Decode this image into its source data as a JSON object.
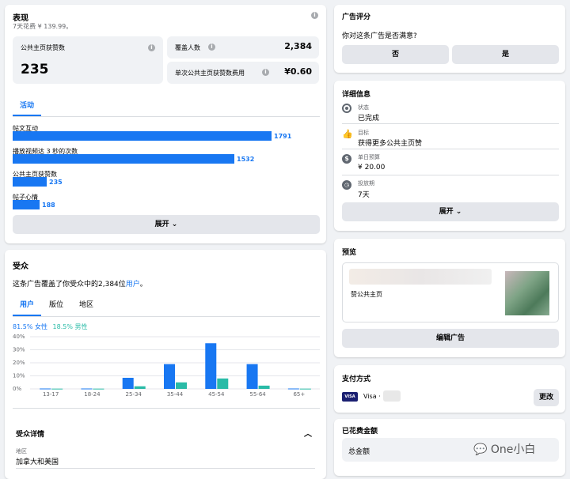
{
  "performance": {
    "title": "表现",
    "subtitle": "7天花费 ¥ 139.99。",
    "page_likes_label": "公共主页获赞数",
    "page_likes_value": "235",
    "reach_label": "覆盖人数",
    "reach_value": "2,384",
    "cost_label": "单次公共主页获赞数费用",
    "cost_value": "¥0.60",
    "activity_tab": "活动",
    "bars": [
      {
        "label": "帖文互动",
        "value": 1791
      },
      {
        "label": "播放视频达 3 秒的次数",
        "value": 1532
      },
      {
        "label": "公共主页获赞数",
        "value": 235
      },
      {
        "label": "帖子心情",
        "value": 188
      }
    ],
    "expand_label": "展开 ⌄"
  },
  "audience": {
    "title": "受众",
    "desc_prefix": "这条广告覆盖了你受众中的2,384位",
    "desc_link": "用户",
    "desc_suffix": "。",
    "tabs": [
      "用户",
      "版位",
      "地区"
    ],
    "female_legend": "81.5% 女性",
    "male_legend": "18.5% 男性",
    "details_title": "受众详情",
    "region_label": "地区",
    "region_value": "加拿大和美国"
  },
  "chart_data": {
    "type": "bar",
    "categories": [
      "13-17",
      "18-24",
      "25-34",
      "35-44",
      "45-54",
      "55-64",
      "65+"
    ],
    "series": [
      {
        "name": "女性",
        "values": [
          0.3,
          0.3,
          8.5,
          19,
          35,
          19,
          0.3
        ],
        "color": "#1877f2"
      },
      {
        "name": "男性",
        "values": [
          0.2,
          0.2,
          2,
          5,
          8,
          2.5,
          0.2
        ],
        "color": "#2abba7"
      }
    ],
    "yticks": [
      "40%",
      "30%",
      "20%",
      "10%",
      "0%"
    ],
    "ylim": [
      0,
      40
    ]
  },
  "rating": {
    "title": "广告评分",
    "question": "你对这条广告是否满意?",
    "no_label": "否",
    "yes_label": "是"
  },
  "details": {
    "title": "详细信息",
    "items": [
      {
        "label": "状态",
        "value": "已完成"
      },
      {
        "label": "目标",
        "value": "获得更多公共主页赞"
      },
      {
        "label": "单日预算",
        "value": "¥ 20.00"
      },
      {
        "label": "投放期",
        "value": "7天"
      }
    ],
    "expand_label": "展开 ⌄"
  },
  "preview": {
    "title": "预览",
    "caption": "赞公共主页",
    "edit_label": "编辑广告"
  },
  "payment": {
    "title": "支付方式",
    "card_brand": "VISA",
    "card_text": "Visa · ",
    "change_label": "更改"
  },
  "spent": {
    "title": "已花费金额",
    "total_label": "总金额"
  },
  "watermark": "One小白"
}
